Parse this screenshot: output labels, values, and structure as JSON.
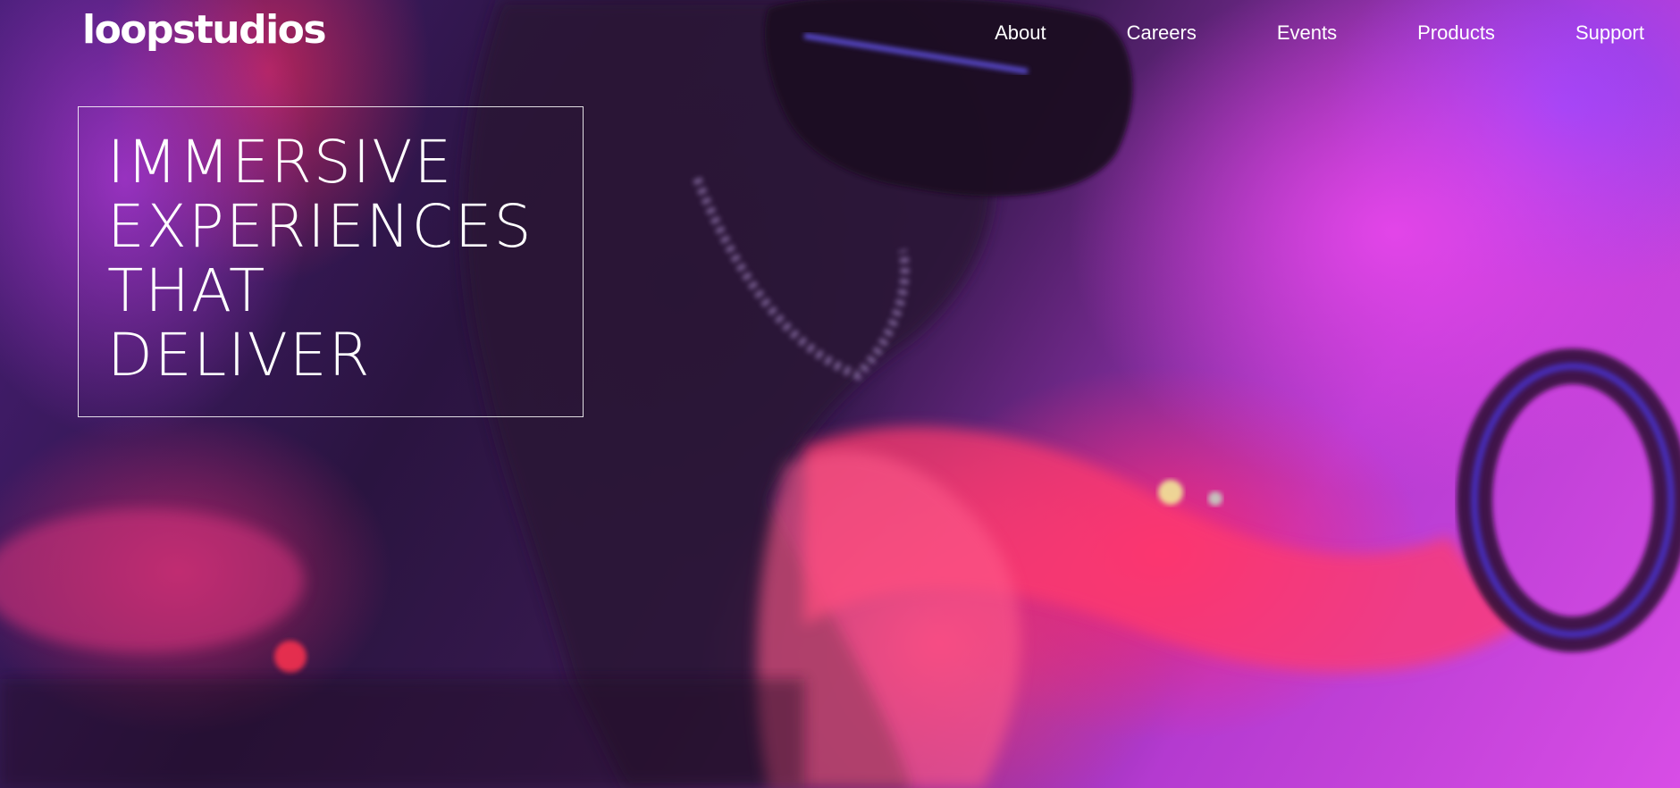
{
  "brand": {
    "logo_text": "loopstudios"
  },
  "nav": {
    "links": [
      {
        "label": "About"
      },
      {
        "label": "Careers"
      },
      {
        "label": "Events"
      },
      {
        "label": "Products"
      },
      {
        "label": "Support"
      }
    ]
  },
  "hero": {
    "headline_lines": [
      "IMMERSIVE",
      "EXPERIENCES",
      "THAT",
      "DELIVER"
    ],
    "image_description_icon": "vr-headset-photo"
  },
  "colors": {
    "text": "#ffffff",
    "magenta": "#d84de6",
    "pink": "#ff2870",
    "violet": "#4a1f7a"
  }
}
